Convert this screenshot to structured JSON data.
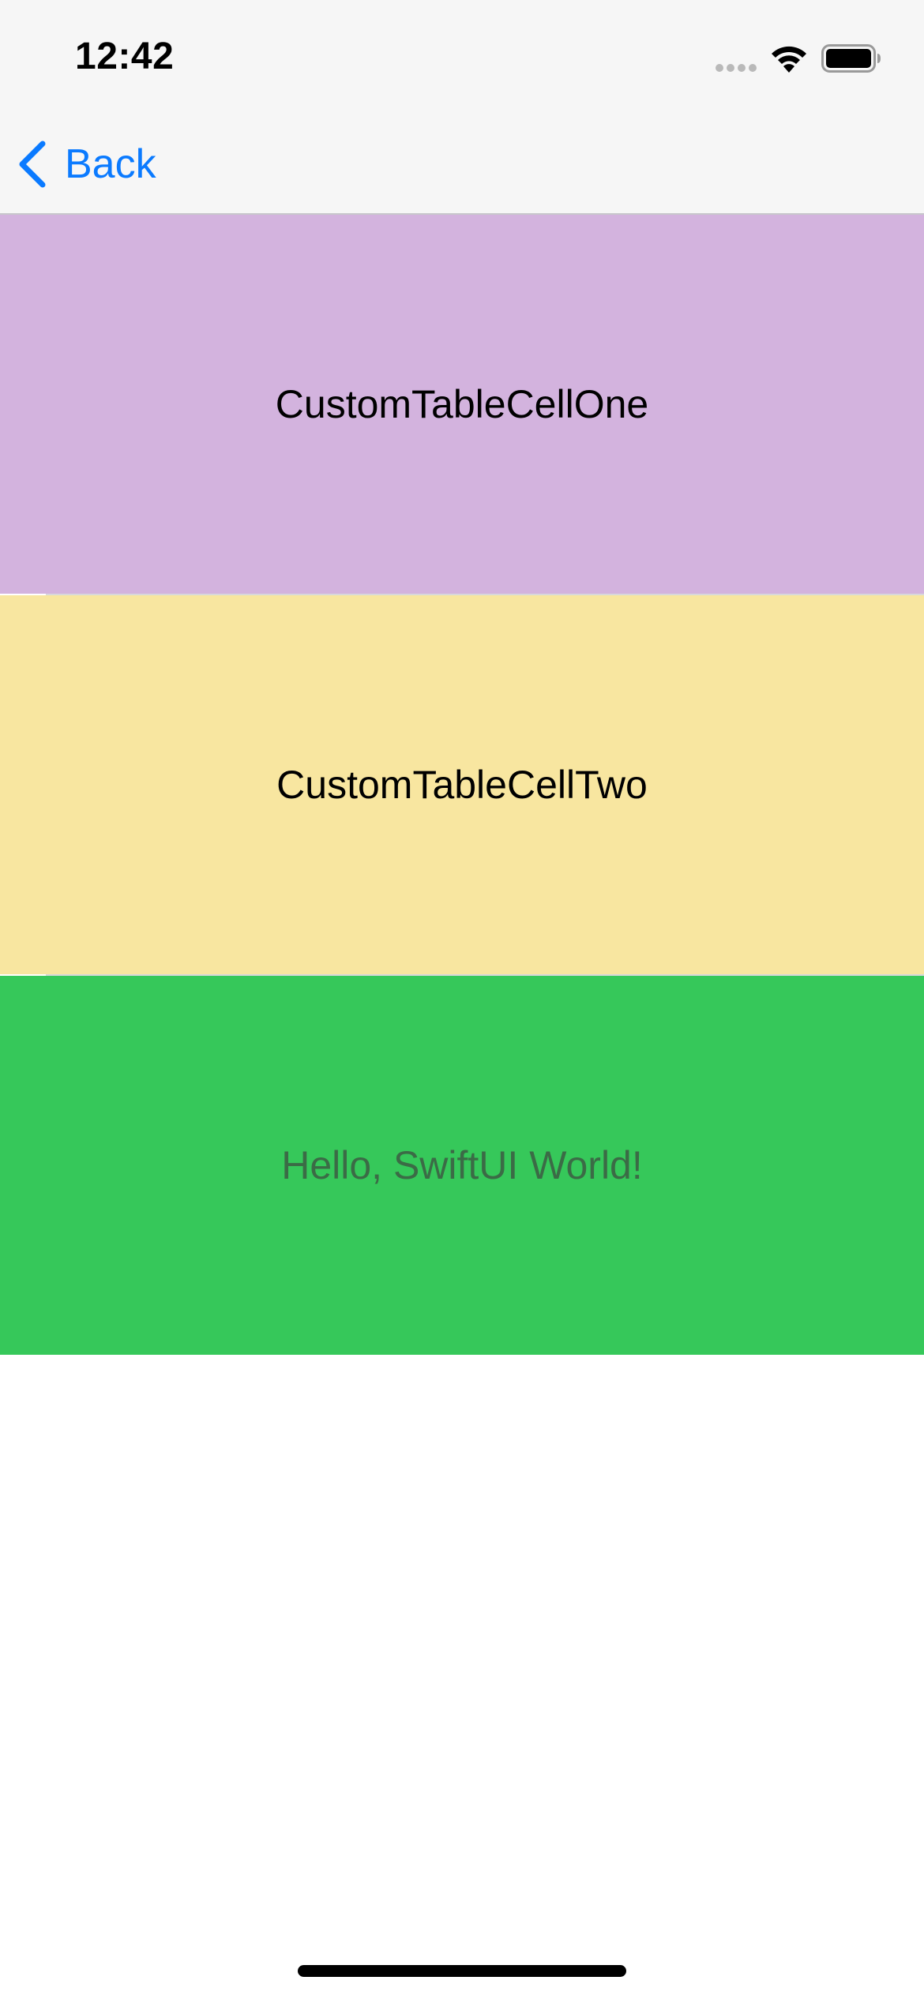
{
  "status_bar": {
    "time": "12:42",
    "icons": [
      "cellular-signal-icon",
      "wifi-icon",
      "battery-icon"
    ]
  },
  "nav_bar": {
    "back_label": "Back",
    "back_icon": "chevron-left-icon",
    "accent_color": "#0a7aff"
  },
  "cells": [
    {
      "label": "CustomTableCellOne",
      "background": "#d3b3de"
    },
    {
      "label": "CustomTableCellTwo",
      "background": "#f8e6a0"
    },
    {
      "label": "Hello, SwiftUI World!",
      "background": "#36c85a"
    }
  ]
}
